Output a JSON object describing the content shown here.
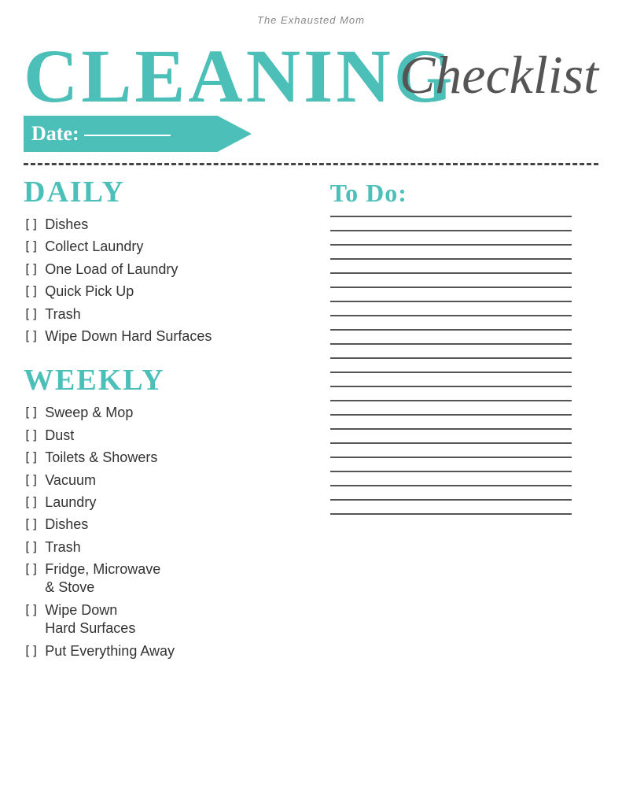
{
  "site_name": "The Exhausted Mom",
  "title_cleaning": "Cleaning",
  "title_checklist": "Checklist",
  "date_label": "Date:",
  "teal_color": "#4bbfb8",
  "sections": {
    "daily": {
      "header": "Daily",
      "items": [
        "Dishes",
        "Collect Laundry",
        "One Load of Laundry",
        "Quick Pick Up",
        "Trash",
        "Wipe Down Hard Surfaces"
      ]
    },
    "weekly": {
      "header": "Weekly",
      "items": [
        "Sweep & Mop",
        "Dust",
        "Toilets & Showers",
        "Vacuum",
        "Laundry",
        "Dishes",
        "Trash",
        "Fridge, Microwave & Stove",
        "Wipe Down Hard Surfaces",
        "Put Everything Away"
      ]
    },
    "todo": {
      "header": "To Do:",
      "lines": 22
    }
  }
}
